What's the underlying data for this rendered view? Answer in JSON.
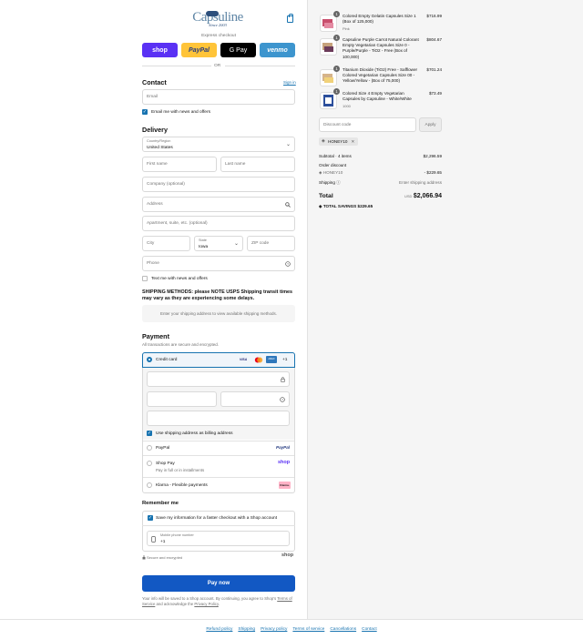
{
  "header": {
    "logo_text": "Capsuline",
    "logo_since": "Since 2003"
  },
  "express": {
    "label": "Express checkout",
    "buttons": {
      "shop": "shop",
      "paypal": "PayPal",
      "gpay": "G Pay",
      "venmo": "venmo"
    },
    "or": "OR"
  },
  "contact": {
    "title": "Contact",
    "sign_in": "Sign in",
    "email_placeholder": "Email",
    "newsletter_label": "Email me with news and offers"
  },
  "delivery": {
    "title": "Delivery",
    "country_label": "Country/Region",
    "country_value": "United States",
    "first_name": "First name",
    "last_name": "Last name",
    "company": "Company (optional)",
    "address": "Address",
    "apartment": "Apartment, suite, etc. (optional)",
    "city": "City",
    "state_label": "State",
    "state_value": "Iowa",
    "zip": "ZIP code",
    "phone": "Phone",
    "text_offers": "Text me with news and offers"
  },
  "shipping": {
    "notice": "SHIPPING METHODS: please NOTE USPS Shipping transit times may vary as they are experiencing some delays.",
    "placeholder": "Enter your shipping address to view available shipping methods."
  },
  "payment": {
    "title": "Payment",
    "subtitle": "All transactions are secure and encrypted.",
    "credit_card": "Credit card",
    "more_cards": "+1",
    "card_brands": {
      "visa": "VISA",
      "amex": "AMEX"
    },
    "billing_same": "Use shipping address as billing address",
    "paypal": "PayPal",
    "paypal_logo": "PayPal",
    "shoppay": "Shop Pay",
    "shoppay_sub": "Pay in full or in installments",
    "shoppay_logo": "shop",
    "klarna": "Klarna - Flexible payments",
    "klarna_logo": "Klarna."
  },
  "remember": {
    "title": "Remember me",
    "save_label": "Save my information for a faster checkout with a Shop account",
    "phone_label": "Mobile phone number",
    "phone_value": "+1",
    "secure": "Secure and encrypted",
    "shop_logo": "shop"
  },
  "pay_now": "Pay now",
  "legal": {
    "text1": "Your info will be saved to a Shop account. By continuing, you agree to Shop's",
    "terms": "Terms of Service",
    "text2": "and acknowledge the",
    "privacy": "Privacy Policy",
    "end": "."
  },
  "footer": [
    "Refund policy",
    "Shipping",
    "Privacy policy",
    "Terms of service",
    "Cancellations",
    "Contact"
  ],
  "cart": {
    "items": [
      {
        "qty": "1",
        "title": "Colored Empty Gelatin Capsules Size 1 (Box of 125,000)",
        "variant": "Pink",
        "price": "$716.99"
      },
      {
        "qty": "1",
        "title": "Capsuline Purple Carrot Natural Colorant Empty Vegetarian Capsules Size 0 - Purple/Purple - TiO2 - Free (Box of 100,000)",
        "variant": "",
        "price": "$804.67"
      },
      {
        "qty": "1",
        "title": "Titanium Dioxide (TiO2) Free - Safflower Colored Vegetarian Capsules Size 00 - Yellow/Yellow - (Box of 75,000)",
        "variant": "",
        "price": "$701.24"
      },
      {
        "qty": "1",
        "title": "Colored Size 4 Empty Vegetarian Capsules by Capsuline - White/White",
        "variant": "1000",
        "price": "$73.49"
      }
    ],
    "discount_placeholder": "Discount code",
    "apply": "Apply",
    "code_tag": "HONEY10",
    "subtotal_label": "Subtotal · 4 items",
    "subtotal": "$2,296.59",
    "order_discount": "Order discount",
    "discount_code": "HONEY10",
    "discount_value": "- $229.65",
    "shipping_label": "Shipping",
    "shipping_value": "Enter shipping address",
    "total_label": "Total",
    "currency": "USD",
    "total": "$2,066.94",
    "savings_label": "TOTAL SAVINGS",
    "savings": "$229.65"
  }
}
